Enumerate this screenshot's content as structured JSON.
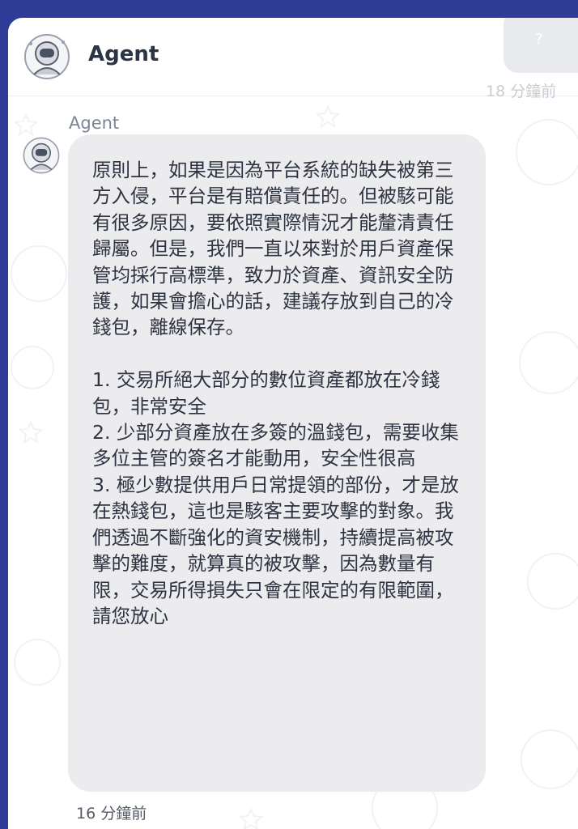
{
  "header": {
    "title": "Agent",
    "avatar_icon": "astronaut-avatar-icon"
  },
  "previous_message": {
    "icon": "question-icon",
    "icon_glyph": "?",
    "time": "18 分鐘前"
  },
  "message": {
    "sender": "Agent",
    "avatar_icon": "astronaut-avatar-icon",
    "text": "原則上，如果是因為平台系統的缺失被第三方入侵，平台是有賠償責任的。但被駭可能有很多原因，要依照實際情況才能釐清責任歸屬。但是，我們一直以來對於用戶資產保管均採行高標準，致力於資產、資訊安全防護，如果會擔心的話，建議存放到自己的冷錢包，離線保存。\n\n1. 交易所絕大部分的數位資產都放在冷錢包，非常安全\n2. 少部分資產放在多簽的溫錢包，需要收集多位主管的簽名才能動用，安全性很高\n3. 極少數提供用戶日常提領的部份，才是放在熱錢包，這也是駭客主要攻擊的對象。我們透過不斷強化的資安機制，持續提高被攻擊的難度，就算真的被攻擊，因為數量有限，交易所得損失只會在限定的有限範圍，請您放心",
    "time": "16 分鐘前"
  },
  "colors": {
    "top_bar": "#2f3c97",
    "bubble_bg": "#ececee",
    "text": "#2d3340",
    "muted": "#7d8593"
  }
}
